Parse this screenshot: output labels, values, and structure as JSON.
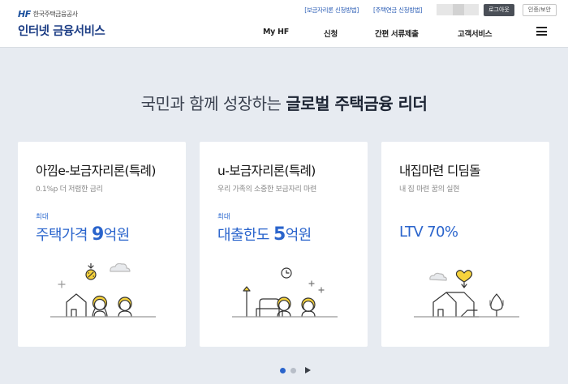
{
  "header": {
    "logo_mark": "HF",
    "logo_corp": "한국주택금융공사",
    "service_name": "인터넷 금융서비스",
    "util_links": [
      "[보금자리론 신청방법]",
      "[주택연금 신청방법]"
    ],
    "logout_label": "로그아웃",
    "cert_label": "인증/보안",
    "nav": [
      "My HF",
      "신청",
      "간편 서류제출",
      "고객서비스"
    ]
  },
  "slogan": {
    "regular": "국민과 함께 성장하는 ",
    "bold": "글로벌 주택금융 리더"
  },
  "cards": [
    {
      "title": "아낌e-보금자리론(특례)",
      "desc": "0.1%p 더 저렴한 금리",
      "label": "최대",
      "value_prefix": "주택가격 ",
      "value_number": "9",
      "value_suffix": "억원"
    },
    {
      "title": "u-보금자리론(특례)",
      "desc": "우리 가족의 소중한 보금자리 마련",
      "label": "최대",
      "value_prefix": "대출한도 ",
      "value_number": "5",
      "value_suffix": "억원"
    },
    {
      "title": "내집마련 디딤돌",
      "desc": "내 집 마련 꿈의 실현",
      "label": "",
      "value_prefix": "",
      "value_number": "LTV 70%",
      "value_suffix": ""
    }
  ],
  "pager": {
    "current_slide": 1,
    "slide_count": 2
  },
  "colors": {
    "accent": "#2a64cc",
    "brand_navy": "#1e3f86",
    "background": "#e7ebf1",
    "yellow": "#f6d23c"
  },
  "icons": [
    "menu-icon",
    "next-arrow-icon",
    "house-family-illustration",
    "clock-family-illustration",
    "house-heart-illustration"
  ]
}
